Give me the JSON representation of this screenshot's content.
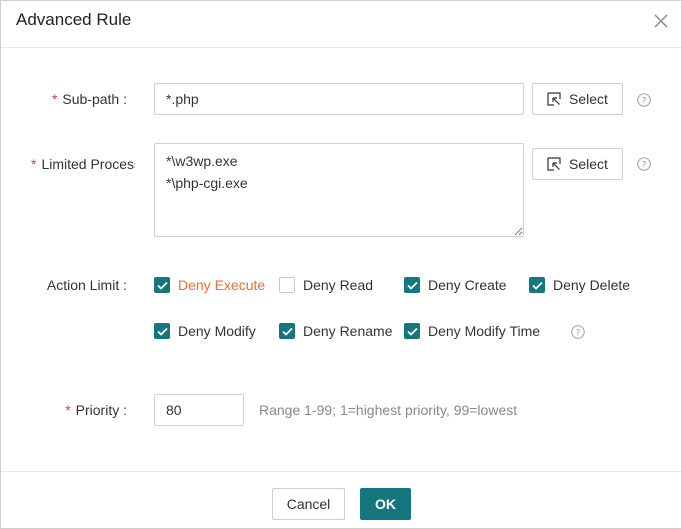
{
  "dialog": {
    "title": "Advanced Rule",
    "close_icon": "close-icon"
  },
  "form": {
    "required_mark": "*",
    "subpath": {
      "label": "Sub-path :",
      "value": "*.php",
      "select_label": "Select"
    },
    "process": {
      "label": "Limited Process :",
      "value": "*\\w3wp.exe\n*\\php-cgi.exe",
      "select_label": "Select"
    },
    "action": {
      "label": "Action Limit :",
      "options": [
        {
          "label": "Deny Execute",
          "checked": true,
          "highlight": true
        },
        {
          "label": "Deny Read",
          "checked": false,
          "highlight": false
        },
        {
          "label": "Deny Create",
          "checked": true,
          "highlight": false
        },
        {
          "label": "Deny Delete",
          "checked": true,
          "highlight": false
        },
        {
          "label": "Deny Modify",
          "checked": true,
          "highlight": false
        },
        {
          "label": "Deny Rename",
          "checked": true,
          "highlight": false
        },
        {
          "label": "Deny Modify Time",
          "checked": true,
          "highlight": false
        }
      ]
    },
    "priority": {
      "label": "Priority :",
      "value": "80",
      "hint": "Range 1-99; 1=highest priority, 99=lowest"
    }
  },
  "footer": {
    "cancel_label": "Cancel",
    "ok_label": "OK"
  },
  "colors": {
    "accent": "#15777d",
    "required": "#e0393e",
    "highlight": "#ee6b31"
  }
}
